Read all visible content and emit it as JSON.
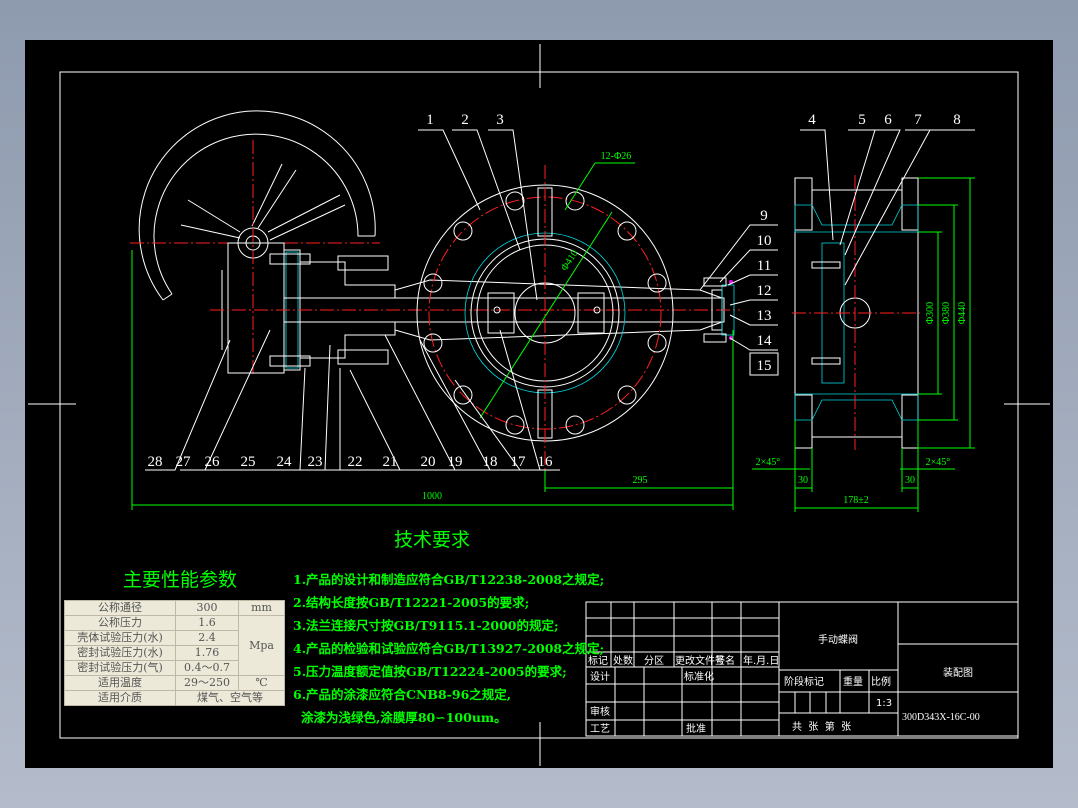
{
  "drawing": {
    "part_numbers_top_left": [
      "1",
      "2",
      "3"
    ],
    "part_numbers_top_right": [
      "4",
      "5",
      "6",
      "7",
      "8"
    ],
    "part_numbers_right": [
      "9",
      "10",
      "11",
      "12",
      "13",
      "14",
      "15"
    ],
    "part_numbers_bottom": [
      "28",
      "27",
      "26",
      "25",
      "24",
      "23",
      "22",
      "21",
      "20",
      "19",
      "18",
      "17",
      "16"
    ],
    "dimensions": {
      "bolt_holes": "12-Φ26",
      "bolt_circle": "Φ410",
      "overall_length": "1000",
      "shaft_end": "295",
      "chamfer_left": "2×45°",
      "chamfer_right": "2×45°",
      "flange_thk_left": "30",
      "flange_thk_right": "30",
      "face_to_face": "178±2",
      "dia_300": "Φ300",
      "dia_380": "Φ380",
      "dia_440": "Φ440"
    },
    "colors": {
      "background": "#000000",
      "outline": "#ffffff",
      "centerline": "#ff2020",
      "dimension": "#00ff00",
      "hatch": "#00d8e0"
    }
  },
  "parameters": {
    "title": "主要性能参数",
    "rows": [
      {
        "label": "公称通径",
        "value": "300",
        "unit": "mm"
      },
      {
        "label": "公称压力",
        "value": "1.6",
        "unit": "Mpa"
      },
      {
        "label": "壳体试验压力(水)",
        "value": "2.4"
      },
      {
        "label": "密封试验压力(水)",
        "value": "1.76"
      },
      {
        "label": "密封试验压力(气)",
        "value": "0.4～0.7"
      },
      {
        "label": "适用温度",
        "value": "29～250",
        "unit": "℃"
      },
      {
        "label": "适用介质",
        "value": "煤气、空气等"
      }
    ]
  },
  "requirements": {
    "title": "技术要求",
    "items": [
      "1.产品的设计和制造应符合GB/T12238-2008之规定;",
      "2.结构长度按GB/T12221-2005的要求;",
      "3.法兰连接尺寸按GB/T9115.1-2000的规定;",
      "4.产品的检验和试验应符合GB/T13927-2008之规定;",
      "5.压力温度额定值按GB/T12224-2005的要求;",
      "6.产品的涂漆应符合CNB8-96之规定,",
      "  涂漆为浅绿色,涂膜厚80∽100um。"
    ]
  },
  "title_block": {
    "headers": [
      "标记",
      "处数",
      "分区",
      "更改文件号",
      "签名",
      "年.月.日"
    ],
    "design": "设计",
    "standardization": "标准化",
    "review": "审核",
    "process": "工艺",
    "approve": "批准",
    "stage_mark": "阶段标记",
    "weight": "重量",
    "scale_label": "比例",
    "scale": "1:3",
    "sheets": "共  张  第  张",
    "product_name": "手动蝶阀",
    "drawing_type": "装配图",
    "drawing_number": "300D343X-16C-00"
  }
}
